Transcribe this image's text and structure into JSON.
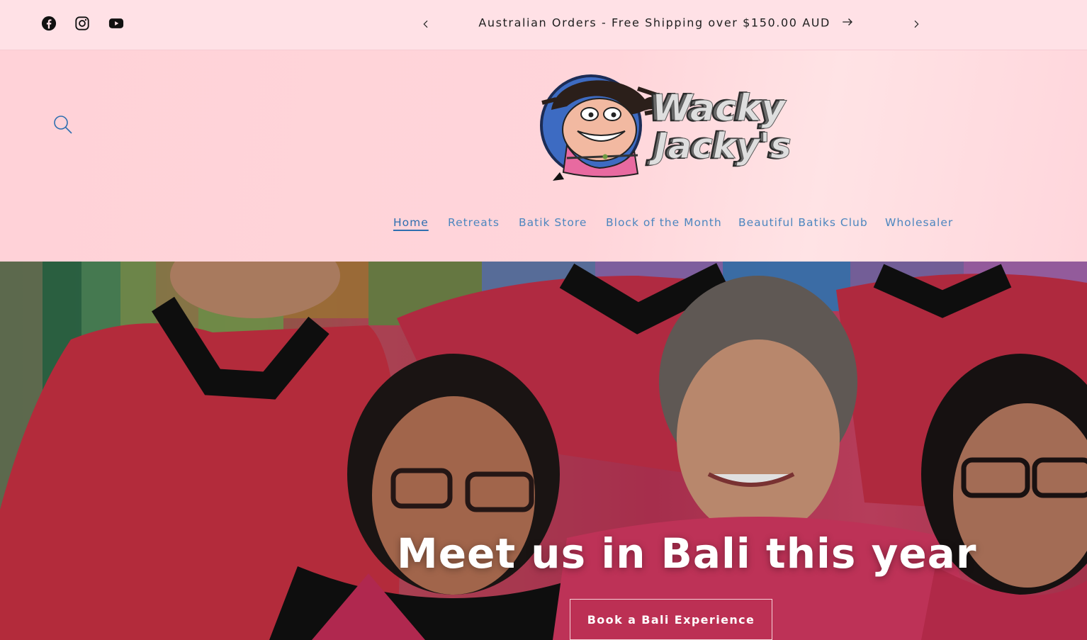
{
  "announcement": {
    "text": "Australian Orders - Free Shipping over $150.00 AUD",
    "prev_icon": "chevron-left-icon",
    "next_icon": "chevron-right-icon",
    "arrow_icon": "arrow-right-icon"
  },
  "social": [
    {
      "icon": "facebook-icon"
    },
    {
      "icon": "instagram-icon"
    },
    {
      "icon": "youtube-icon"
    }
  ],
  "header": {
    "search_icon": "search-icon",
    "logo": {
      "line1": "Wacky",
      "line2": "Jacky's"
    }
  },
  "nav": {
    "items": [
      {
        "label": "Home",
        "active": true
      },
      {
        "label": "Retreats"
      },
      {
        "label": "Batik Store"
      },
      {
        "label": "Block of the Month"
      },
      {
        "label": "Beautiful Batiks Club"
      },
      {
        "label": "Wholesaler"
      }
    ]
  },
  "hero": {
    "title": "Meet us in Bali this year",
    "button_label": "Book a Bali Experience"
  },
  "colors": {
    "announcement_bg": "#ffe1e6",
    "header_bg": "#ffd5da",
    "nav_link": "#4c86bf",
    "hero_red": "#bd3557"
  }
}
